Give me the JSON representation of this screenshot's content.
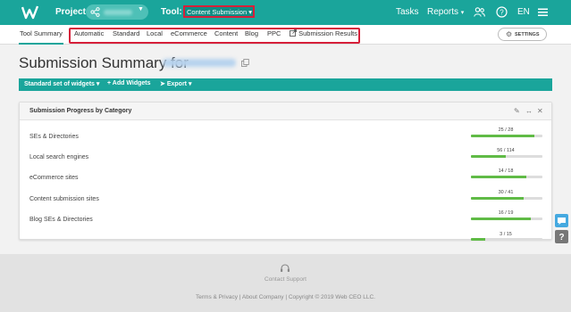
{
  "header": {
    "project_label": "Project:",
    "tool_label": "Tool:",
    "tool_value": "Content Submission",
    "tasks": "Tasks",
    "reports": "Reports",
    "language": "EN",
    "accent_color": "#1aa59b"
  },
  "nav": {
    "first_tab": "Tool Summary",
    "tabs": [
      "Automatic",
      "Standard",
      "Local",
      "eCommerce",
      "Content",
      "Blog",
      "PPC",
      "Submission Results"
    ],
    "settings": "SETTINGS"
  },
  "page": {
    "title": "Submission Summary for"
  },
  "toolbar": {
    "widgets": "Standard set of widgets",
    "add": "+ Add Widgets",
    "export": "Export"
  },
  "widget": {
    "title": "Submission Progress by Category",
    "rows": [
      {
        "label": "SEs & Directories",
        "count": "25 / 28",
        "fraction": 0.893
      },
      {
        "label": "Local search engines",
        "count": "56 / 114",
        "fraction": 0.491
      },
      {
        "label": "eCommerce sites",
        "count": "14 / 18",
        "fraction": 0.778
      },
      {
        "label": "Content submission sites",
        "count": "30 / 41",
        "fraction": 0.732
      },
      {
        "label": "Blog SEs & Directories",
        "count": "16 / 19",
        "fraction": 0.842
      },
      {
        "label": "",
        "count": "3 / 15",
        "fraction": 0.2
      }
    ]
  },
  "footer": {
    "support": "Contact Support",
    "links": "Terms & Privacy | About Company | Copyright © 2019 Web CEO LLC."
  }
}
